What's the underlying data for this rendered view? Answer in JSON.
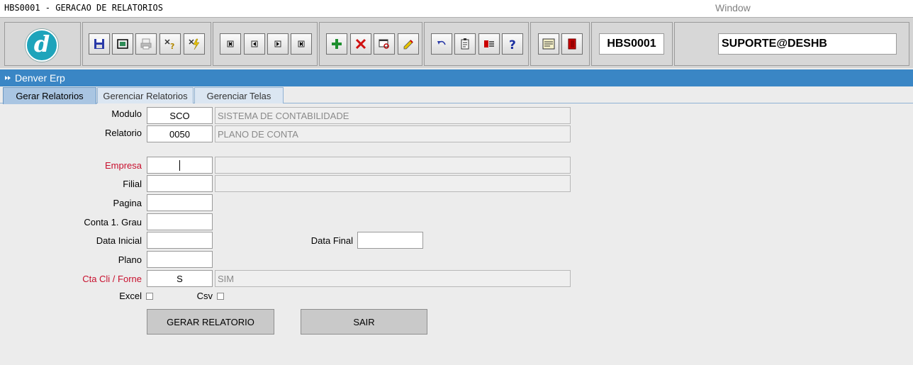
{
  "window": {
    "title": "HBS0001 - GERACAO DE RELATORIOS",
    "menu_item": "Window"
  },
  "toolbar": {
    "form_code": "HBS0001",
    "user": "SUPORTE@DESHB",
    "logo_letter": "d",
    "buttons": [
      {
        "name": "save-icon"
      },
      {
        "name": "clear-form-icon"
      },
      {
        "name": "print-icon"
      },
      {
        "name": "query-icon"
      },
      {
        "name": "execute-query-icon"
      },
      {
        "name": "first-record-icon"
      },
      {
        "name": "previous-record-icon"
      },
      {
        "name": "next-record-icon"
      },
      {
        "name": "last-record-icon"
      },
      {
        "name": "insert-record-icon"
      },
      {
        "name": "delete-record-icon"
      },
      {
        "name": "duplicate-record-icon"
      },
      {
        "name": "edit-field-icon"
      },
      {
        "name": "undo-icon"
      },
      {
        "name": "clipboard-icon"
      },
      {
        "name": "list-values-icon"
      },
      {
        "name": "help-icon"
      },
      {
        "name": "menu-icon"
      },
      {
        "name": "exit-icon"
      }
    ]
  },
  "frame": {
    "title": "Denver Erp"
  },
  "tabs": [
    {
      "label": "Gerar Relatorios",
      "active": true
    },
    {
      "label": "Gerenciar Relatorios",
      "active": false
    },
    {
      "label": "Gerenciar Telas",
      "active": false
    }
  ],
  "form": {
    "modulo": {
      "label": "Modulo",
      "code": "SCO",
      "description": "SISTEMA DE CONTABILIDADE"
    },
    "relatorio": {
      "label": "Relatorio",
      "code": "0050",
      "description": "PLANO DE CONTA"
    },
    "empresa": {
      "label": "Empresa",
      "value": "",
      "description": ""
    },
    "filial": {
      "label": "Filial",
      "value": "",
      "description": ""
    },
    "pagina": {
      "label": "Pagina",
      "value": ""
    },
    "conta": {
      "label": "Conta 1. Grau",
      "value": ""
    },
    "data_inicial": {
      "label": "Data Inicial",
      "value": ""
    },
    "data_final": {
      "label": "Data Final",
      "value": ""
    },
    "plano": {
      "label": "Plano",
      "value": ""
    },
    "cta_cli": {
      "label": "Cta Cli / Forne",
      "value": "S",
      "description": "SIM"
    },
    "excel": {
      "label": "Excel",
      "checked": false
    },
    "csv": {
      "label": "Csv",
      "checked": false
    }
  },
  "actions": {
    "generate": "GERAR RELATORIO",
    "exit": "SAIR"
  },
  "colors": {
    "frame_title_bg": "#3a86c5",
    "required_label": "#c8102e",
    "logo_bg": "#1ea4bb"
  }
}
